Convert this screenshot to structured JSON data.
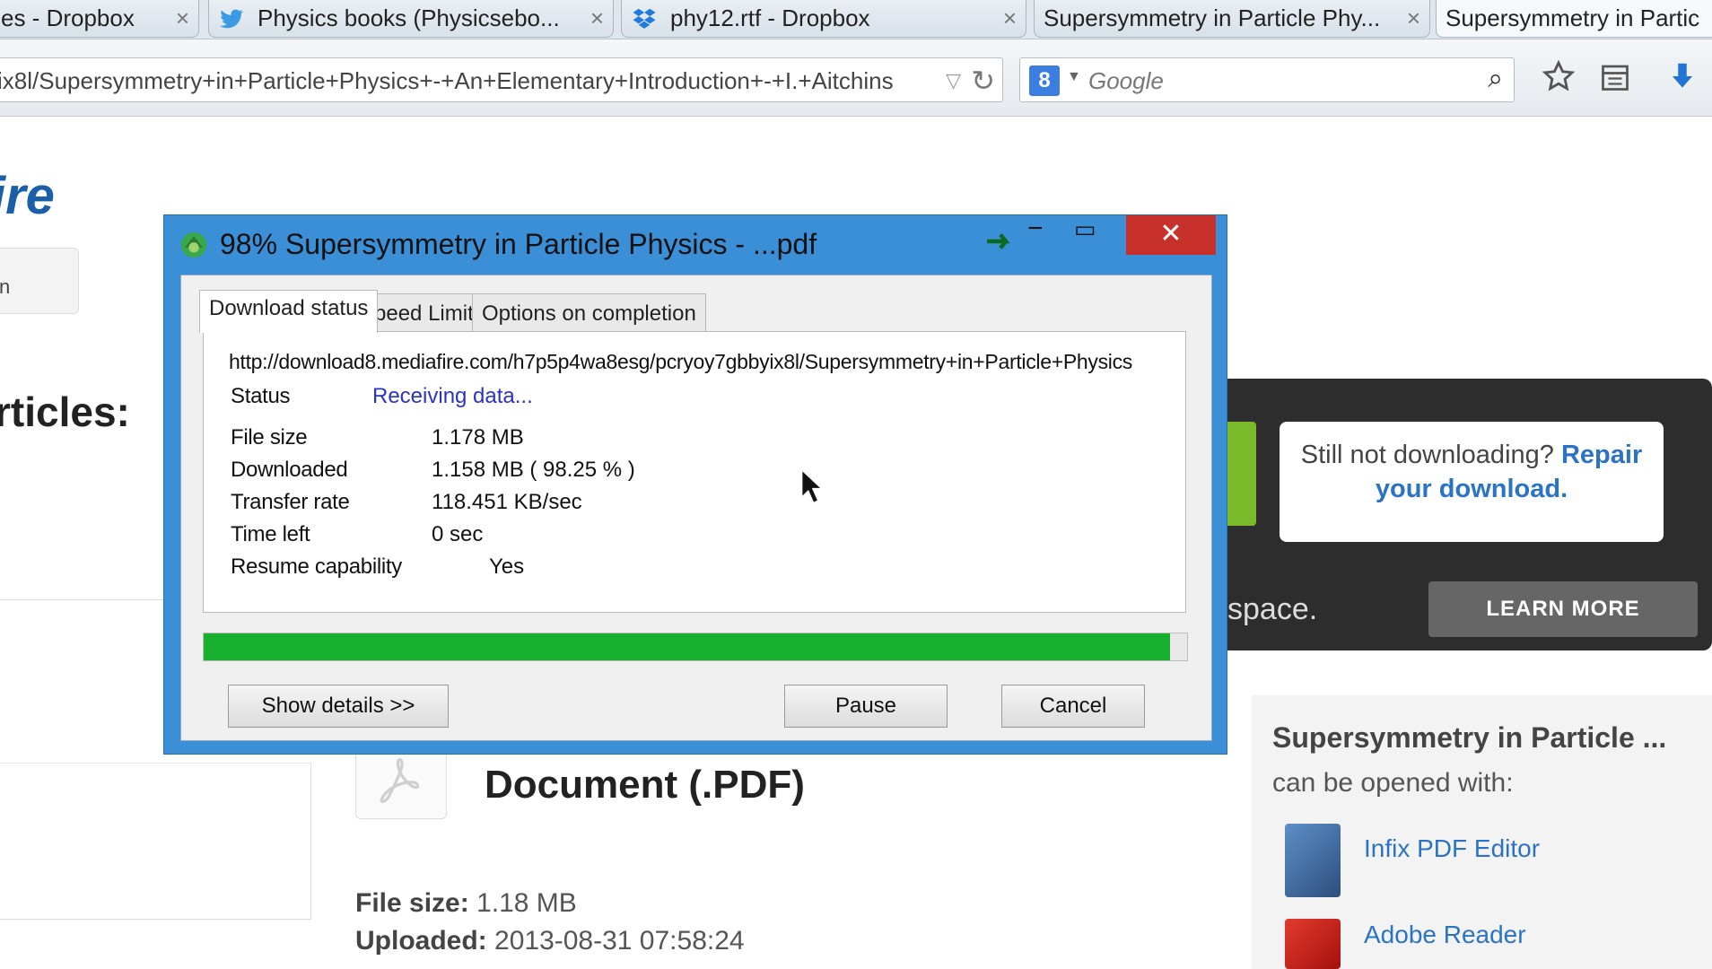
{
  "browser": {
    "tabs": [
      {
        "label": "es - Dropbox",
        "icon": "dropbox-icon"
      },
      {
        "label": "Physics books (Physicsebo...",
        "icon": "twitter-icon"
      },
      {
        "label": "phy12.rtf - Dropbox",
        "icon": "dropbox-icon"
      },
      {
        "label": "Supersymmetry in Particle Phy...",
        "icon": ""
      },
      {
        "label": "Supersymmetry in Partic",
        "icon": ""
      }
    ],
    "tab_close": "×",
    "url": "ix8l/Supersymmetry+in+Particle+Physics+-+An+Elementary+Introduction+-+I.+Aitchins",
    "search_engine_icon": "google-icon",
    "search_placeholder": "Google",
    "search_engine_letter": "8"
  },
  "page": {
    "logo_text": "ire",
    "side_button": "n",
    "articles_heading": "rticles:",
    "banner": {
      "note_text": "Still not downloading?",
      "note_link": "Repair your download.",
      "tagline": "space.",
      "learn_more": "LEARN MORE"
    },
    "document_type": "Document (.PDF)",
    "file_size_label": "File size:",
    "file_size_value": "1.18 MB",
    "uploaded_label": "Uploaded:",
    "uploaded_value": "2013-08-31 07:58:24",
    "opens_title": "Supersymmetry in Particle ...",
    "opens_subtitle": "can be opened with:",
    "apps": [
      {
        "name": "Infix PDF Editor",
        "icon": "infix-pdf-editor-icon"
      },
      {
        "name": "Adobe Reader",
        "icon": "adobe-reader-icon"
      }
    ]
  },
  "dialog": {
    "title": "98% Supersymmetry in Particle Physics - ...pdf",
    "close": "✕",
    "tabs": [
      "Download status",
      "Speed Limiter",
      "Options on completion"
    ],
    "url": "http://download8.mediafire.com/h7p5p4wa8esg/pcryoy7gbbyix8l/Supersymmetry+in+Particle+Physics",
    "status_label": "Status",
    "status_value": "Receiving data...",
    "rows": [
      {
        "label": "File size",
        "value": "1.178  MB"
      },
      {
        "label": "Downloaded",
        "value": "1.158  MB  ( 98.25 % )"
      },
      {
        "label": "Transfer rate",
        "value": "118.451  KB/sec"
      },
      {
        "label": "Time left",
        "value": "0 sec"
      },
      {
        "label": "Resume capability",
        "value": "Yes"
      }
    ],
    "progress": 0.9825,
    "colors": {
      "progress": "#17b12f",
      "titlebar": "#3b8fd6",
      "close": "#c7302b"
    },
    "buttons": {
      "details": "Show details >>",
      "pause": "Pause",
      "cancel": "Cancel"
    }
  }
}
